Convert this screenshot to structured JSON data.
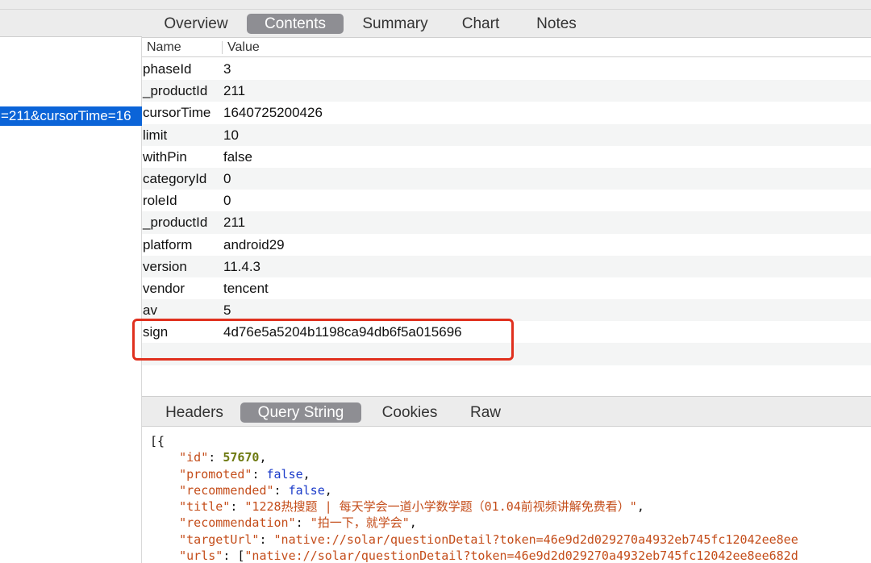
{
  "sidebar": {
    "selected_row_text": "=211&cursorTime=16"
  },
  "tabs": [
    "Overview",
    "Contents",
    "Summary",
    "Chart",
    "Notes"
  ],
  "active_tab": "Contents",
  "table": {
    "header_name": "Name",
    "header_value": "Value",
    "rows": [
      {
        "name": "phaseId",
        "value": "3"
      },
      {
        "name": "_productId",
        "value": "211"
      },
      {
        "name": "cursorTime",
        "value": "1640725200426"
      },
      {
        "name": "limit",
        "value": "10"
      },
      {
        "name": "withPin",
        "value": "false"
      },
      {
        "name": "categoryId",
        "value": "0"
      },
      {
        "name": "roleId",
        "value": "0"
      },
      {
        "name": "_productId",
        "value": "211"
      },
      {
        "name": "platform",
        "value": "android29"
      },
      {
        "name": "version",
        "value": "11.4.3"
      },
      {
        "name": "vendor",
        "value": "tencent"
      },
      {
        "name": "av",
        "value": "5"
      },
      {
        "name": "sign",
        "value": "4d76e5a5204b1198ca94db6f5a015696"
      }
    ]
  },
  "highlight_color": "#e0301e",
  "bottom_tabs": [
    "Headers",
    "Query String",
    "Cookies",
    "Raw"
  ],
  "active_bottom_tab": "Query String",
  "json_lines": {
    "l0": "[{",
    "id_key": "\"id\"",
    "id_val": "57670",
    "promoted_key": "\"promoted\"",
    "promoted_val": "false",
    "recommended_key": "\"recommended\"",
    "recommended_val": "false",
    "title_key": "\"title\"",
    "title_val": "\"1228热搜题 | 每天学会一道小学数学题（01.04前视频讲解免费看）\"",
    "recommendation_key": "\"recommendation\"",
    "recommendation_val": "\"拍一下，就学会\"",
    "targetUrl_key": "\"targetUrl\"",
    "targetUrl_val": "\"native://solar/questionDetail?token=46e9d2d029270a4932eb745fc12042ee8ee",
    "urls_key": "\"urls\"",
    "urls_val": "\"native://solar/questionDetail?token=46e9d2d029270a4932eb745fc12042ee8ee682d"
  }
}
